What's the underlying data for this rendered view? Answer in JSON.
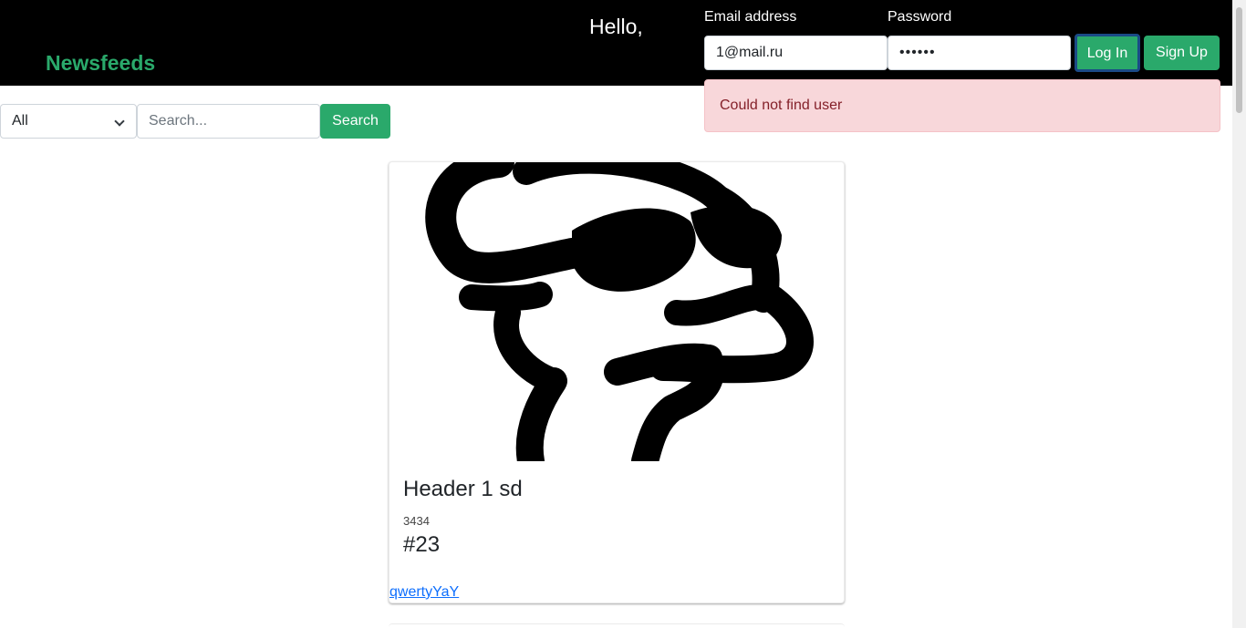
{
  "navbar": {
    "brand": "Newsfeeds",
    "greeting": "Hello,"
  },
  "login": {
    "email_label": "Email address",
    "email_value": "1@mail.ru",
    "password_label": "Password",
    "password_value": "••••••",
    "login_label": "Log In",
    "signup_label": "Sign Up"
  },
  "alert": {
    "message": "Could not find user"
  },
  "filter": {
    "category_selected": "All",
    "search_placeholder": "Search...",
    "search_button": "Search"
  },
  "posts": [
    {
      "title": "Header 1 sd",
      "meta": "3434",
      "tag": "#23",
      "author": "qwertyYaY"
    }
  ],
  "colors": {
    "brand_green": "#2aa96b",
    "navbar_bg": "#000000",
    "alert_bg": "#f8d7da",
    "alert_text": "#842029",
    "link_blue": "#0d6efd"
  }
}
